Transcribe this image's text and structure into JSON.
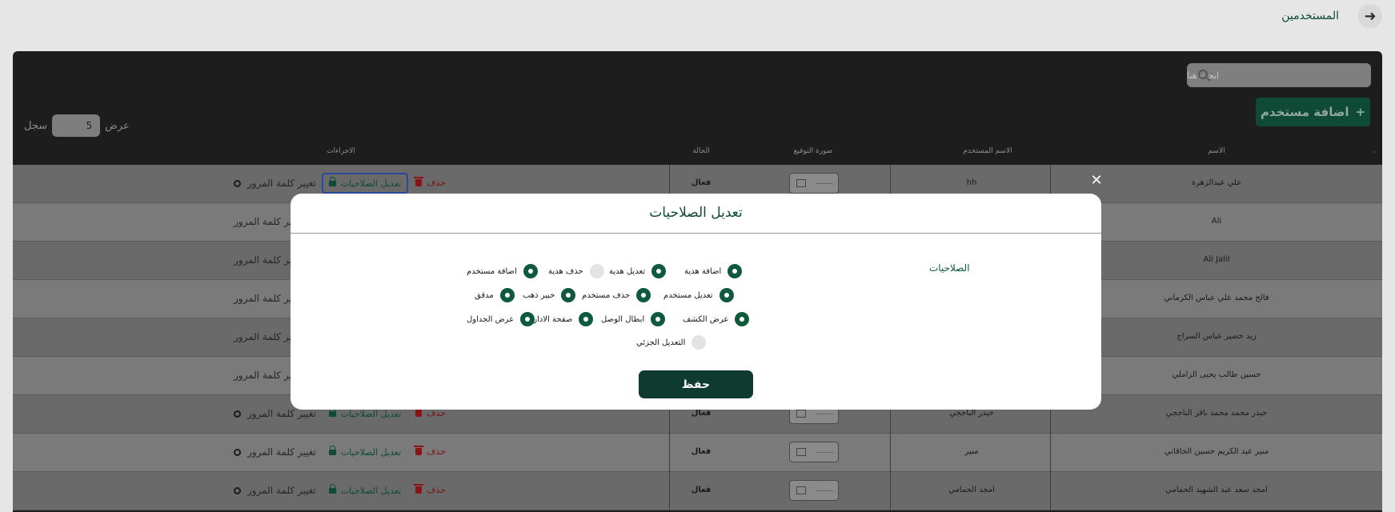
{
  "header": {
    "title": "المستخدمين",
    "back_icon": "arrow-right-icon"
  },
  "toolbar": {
    "search_placeholder": "ابحث هنا",
    "add_label": "اضافة مستخدم",
    "show_label": "عرض",
    "page_size": "5",
    "records_label": "سجل"
  },
  "table": {
    "columns": [
      "الاسم",
      "الاسم المستخدم",
      "صورة التوقيع",
      "الحالة",
      "الاجراءات"
    ],
    "actions": {
      "change_password": "تغيير كلمة المرور",
      "edit_permissions": "تعديل الصلاحيات",
      "delete": "حذف"
    },
    "rows": [
      {
        "name": "علي عبدالزهرة",
        "username": "hh",
        "status": "فعال"
      },
      {
        "name": "Ali",
        "username": "",
        "status": ""
      },
      {
        "name": "Ali Jalil",
        "username": "",
        "status": ""
      },
      {
        "name": "فالح محمد علي عباس الكرماني",
        "username": "",
        "status": ""
      },
      {
        "name": "زيد خضير عباس السراج",
        "username": "",
        "status": ""
      },
      {
        "name": "حسين طالب يحيى الزاملي",
        "username": "",
        "status": ""
      },
      {
        "name": "حيدر محمد محمد باقر الباججي",
        "username": "حيدر الباججي",
        "status": "فعال"
      },
      {
        "name": "منير عبد الكريم حسين الخاقاني",
        "username": "منير",
        "status": "فعال"
      },
      {
        "name": "امجد سعد عبد الشهيد الحمامي",
        "username": "امجد الحمامي",
        "status": "فعال"
      }
    ]
  },
  "modal": {
    "title": "تعديل الصلاحيات",
    "section_label": "الصلاحيات",
    "save_label": "حفظ",
    "permissions": [
      {
        "label": "اضافة هدية",
        "checked": true
      },
      {
        "label": "تعديل هدية",
        "checked": true
      },
      {
        "label": "حذف هدية",
        "checked": false
      },
      {
        "label": "اضافة مستخدم",
        "checked": true
      },
      {
        "label": "تعديل مستخدم",
        "checked": true
      },
      {
        "label": "حذف مستخدم",
        "checked": true
      },
      {
        "label": "خبير ذهب",
        "checked": true
      },
      {
        "label": "مدقق",
        "checked": true
      },
      {
        "label": "عرض الكشف",
        "checked": true
      },
      {
        "label": "ابطال الوصل",
        "checked": true
      },
      {
        "label": "صفحة الادارة",
        "checked": true
      },
      {
        "label": "عرض الجداول",
        "checked": true
      },
      {
        "label": "التعديل الجزئي",
        "checked": false
      }
    ]
  },
  "colors": {
    "brand": "#0f5a3c",
    "danger": "#8a1414",
    "save": "#0e3a30"
  }
}
